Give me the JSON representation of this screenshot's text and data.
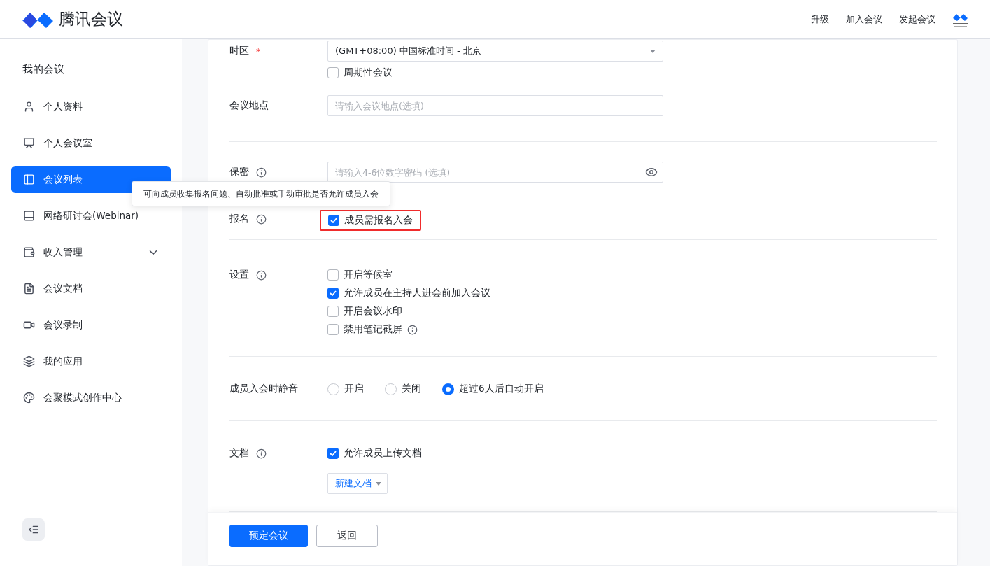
{
  "header": {
    "brand": "腾讯会议",
    "nav": [
      "升级",
      "加入会议",
      "发起会议"
    ]
  },
  "sidebar": {
    "title": "我的会议",
    "items": [
      {
        "label": "个人资料",
        "selected": false
      },
      {
        "label": "个人会议室",
        "selected": false
      },
      {
        "label": "会议列表",
        "selected": true
      },
      {
        "label": "网络研讨会(Webinar)",
        "selected": false
      },
      {
        "label": "收入管理",
        "selected": false,
        "expanded": false
      },
      {
        "label": "会议文档",
        "selected": false
      },
      {
        "label": "会议录制",
        "selected": false
      },
      {
        "label": "我的应用",
        "selected": false
      },
      {
        "label": "会聚模式创作中心",
        "selected": false
      }
    ]
  },
  "form": {
    "sections": [
      {
        "rows": [
          {
            "kind": "select",
            "label": "时区",
            "required_mark": "*",
            "value": "(GMT+08:00) 中国标准时间 - 北京",
            "options": [
              {
                "label": "周期性会议",
                "checked": false
              }
            ]
          },
          {
            "kind": "text",
            "label": "会议地点",
            "placeholder": "请输入会议地点(选填)"
          }
        ]
      },
      {
        "rows": [
          {
            "kind": "password",
            "label": "保密",
            "info": true,
            "placeholder": "请输入4-6位数字密码 (选填)"
          },
          {
            "kind": "checkboxes",
            "label": "报名",
            "info": true,
            "highlighted": true,
            "options": [
              {
                "label": "成员需报名入会",
                "checked": true
              }
            ]
          }
        ]
      },
      {
        "rows": [
          {
            "kind": "checkboxes",
            "label": "设置",
            "info": true,
            "options": [
              {
                "label": "开启等候室",
                "checked": false
              },
              {
                "label": "允许成员在主持人进会前加入会议",
                "checked": true
              },
              {
                "label": "开启会议水印",
                "checked": false
              },
              {
                "label": "禁用笔记截屏",
                "checked": false,
                "info": true
              }
            ]
          }
        ]
      },
      {
        "rows": [
          {
            "kind": "radios",
            "label": "成员入会时静音",
            "options": [
              {
                "label": "开启",
                "selected": false
              },
              {
                "label": "关闭",
                "selected": false
              },
              {
                "label": "超过6人后自动开启",
                "selected": true
              }
            ]
          }
        ]
      },
      {
        "rows": [
          {
            "kind": "checkboxes",
            "label": "文档",
            "info": true,
            "options": [
              {
                "label": "允许成员上传文档",
                "checked": true
              }
            ],
            "button": "新建文档"
          }
        ]
      }
    ]
  },
  "tooltip": "可向成员收集报名问题、自动批准或手动审批是否允许成员入会",
  "footer": {
    "buttons": [
      {
        "label": "预定会议",
        "primary": true
      },
      {
        "label": "返回",
        "primary": false
      }
    ]
  }
}
